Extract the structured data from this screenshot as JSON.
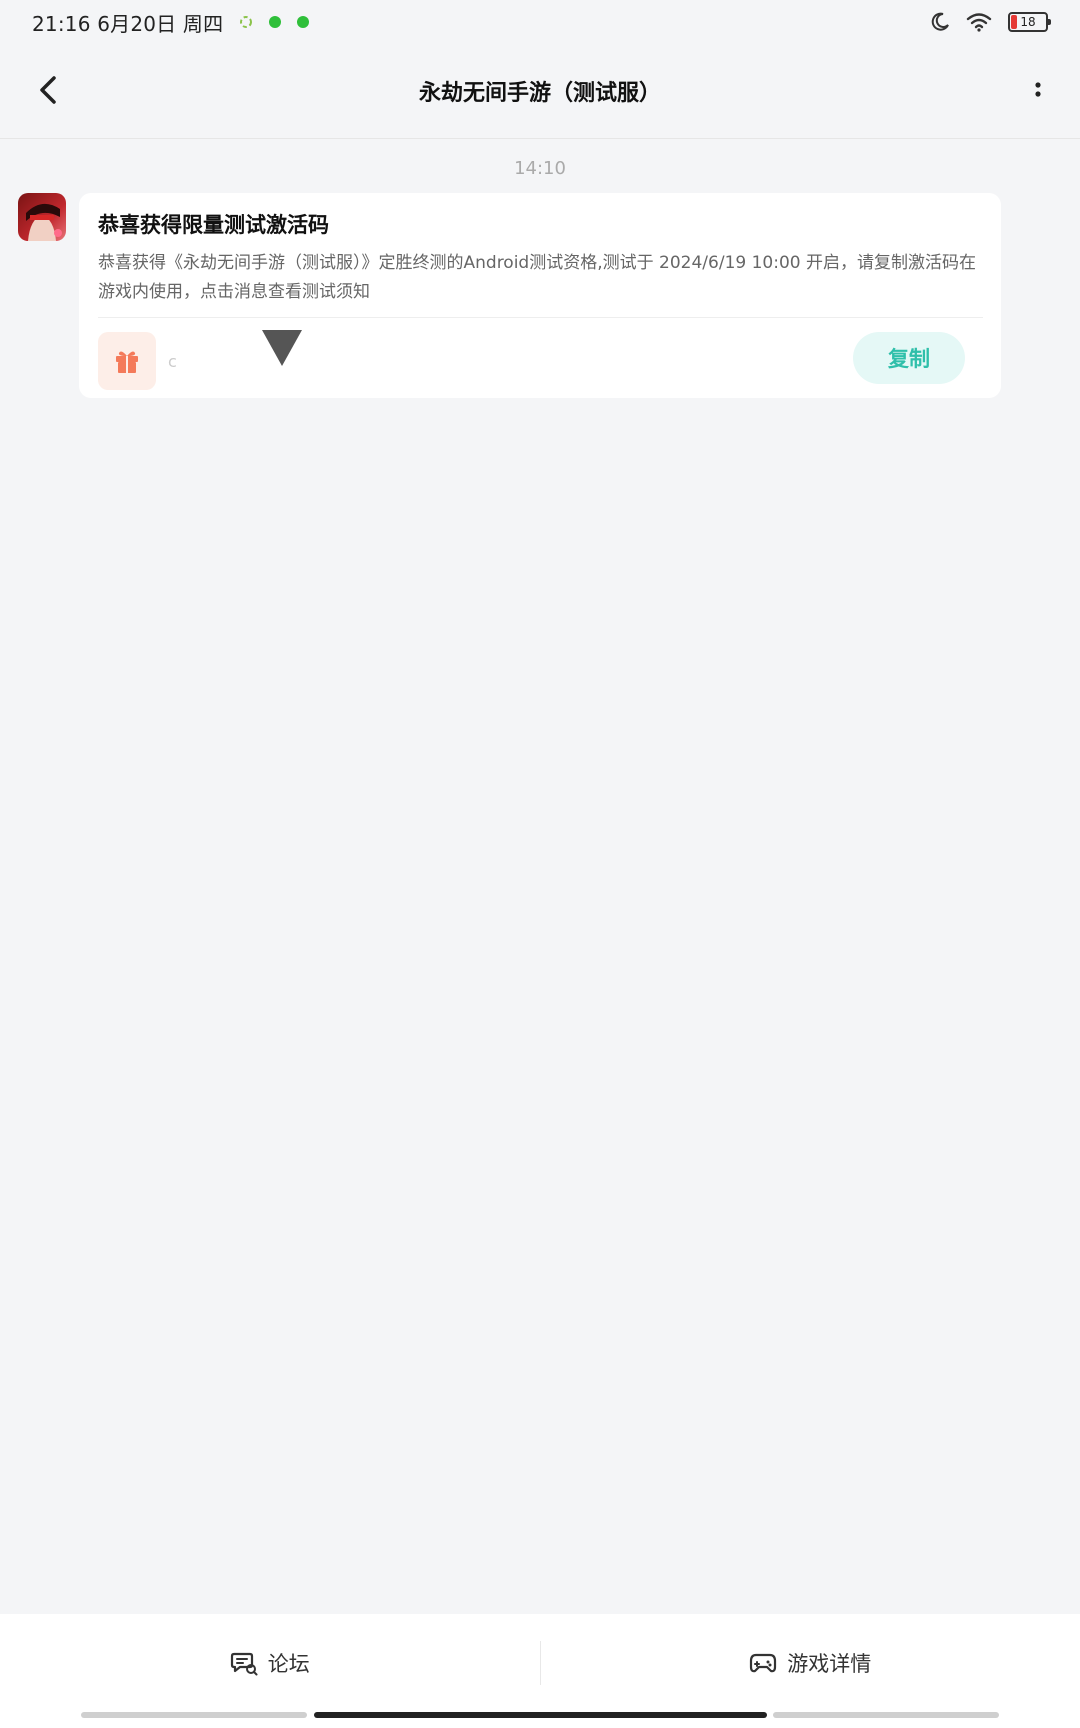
{
  "status_bar": {
    "time": "21:16 6月20日 周四",
    "battery": "18",
    "battery_level_percent": 18
  },
  "header": {
    "title": "永劫无间手游（测试服）"
  },
  "chat": {
    "timestamp": "14:10",
    "message": {
      "title": "恭喜获得限量测试激活码",
      "body": "恭喜获得《永劫无间手游（测试服）》定胜终测的Android测试资格,测试于 2024/6/19 10:00 开启，请复制激活码在游戏内使用，点击消息查看测试须知",
      "code_text": "c",
      "copy_label": "复制"
    }
  },
  "bottom_nav": {
    "forum_label": "论坛",
    "game_details_label": "游戏详情"
  },
  "colors": {
    "accent": "#2fbfaa",
    "copy_bg": "#e5f8f6",
    "gift": "#f47a5a",
    "gift_bg": "#fdeee8",
    "battery_low": "#e53935"
  },
  "icons": {
    "back": "chevron-left-icon",
    "more": "more-vertical-icon",
    "gift": "gift-icon",
    "forum": "forum-chat-icon",
    "game": "gamepad-icon",
    "moon": "moon-icon",
    "wifi": "wifi-icon"
  }
}
